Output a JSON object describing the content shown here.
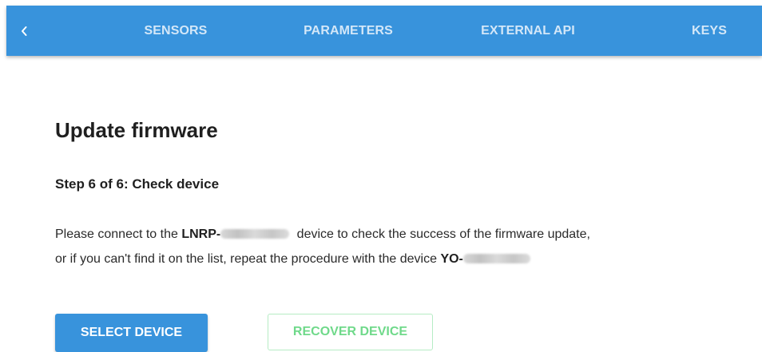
{
  "header": {
    "back_icon": "chevron-left-icon",
    "tabs": [
      {
        "label": "SENSORS"
      },
      {
        "label": "PARAMETERS"
      },
      {
        "label": "EXTERNAL API"
      },
      {
        "label": "KEYS"
      }
    ],
    "bg_color": "#3893dc",
    "tab_color": "#d3e7f8"
  },
  "main": {
    "title": "Update firmware",
    "step": "Step 6 of 6: Check device",
    "desc": {
      "part1": "Please connect to the ",
      "device1_prefix": "LNRP-",
      "part2": " device to check the success of the firmware update,",
      "part3": "or if you can't find it on the list, repeat the procedure with the device ",
      "device2_prefix": "YO-"
    },
    "buttons": {
      "select_label": "SELECT DEVICE",
      "recover_label": "RECOVER DEVICE"
    }
  },
  "colors": {
    "accent": "#3893dc",
    "recover_text": "#6fd98a",
    "recover_border": "#b6ecc4"
  }
}
